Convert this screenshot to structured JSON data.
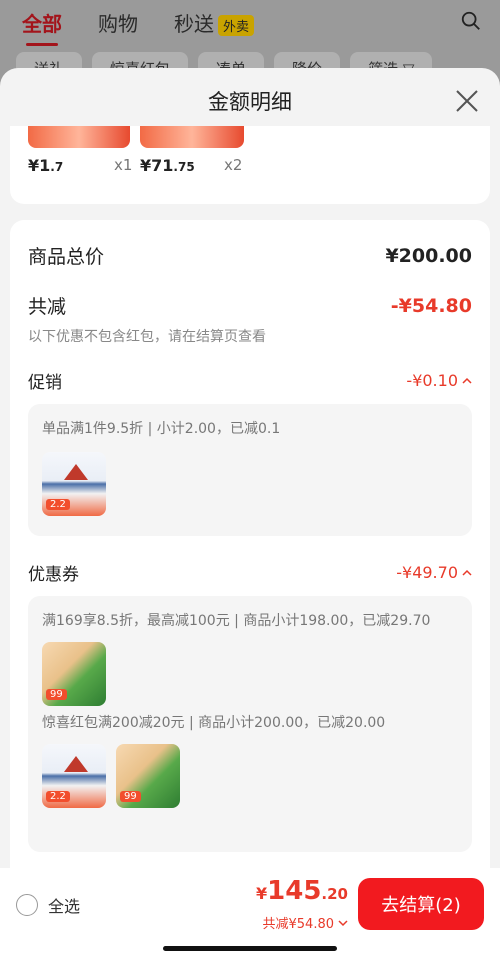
{
  "background_app": {
    "tabs": [
      {
        "label": "全部",
        "active": true
      },
      {
        "label": "购物",
        "active": false
      },
      {
        "label": "秒送",
        "active": false,
        "badge": "外卖"
      }
    ],
    "filters": [
      "送礼",
      "惊喜红包",
      "凑单",
      "降价",
      "筛选 ▽"
    ]
  },
  "sheet": {
    "title": "金额明细",
    "products": [
      {
        "price_main": "¥1",
        "price_dec": ".7",
        "qty": "x1"
      },
      {
        "price_main": "¥71",
        "price_dec": ".75",
        "qty": "x2"
      }
    ],
    "summary": {
      "total_label": "商品总价",
      "total_value": "¥200.00",
      "discount_label": "共减",
      "discount_value": "-¥54.80",
      "note": "以下优惠不包含红包，请在结算页查看"
    },
    "promotion": {
      "label": "促销",
      "value": "-¥0.10",
      "detail": "单品满1件9.5折 | 小计2.00，已减0.1",
      "thumb_tag": "2.2"
    },
    "coupon": {
      "label": "优惠券",
      "value": "-¥49.70",
      "detail1": "满169享8.5折，最高减100元 | 商品小计198.00，已减29.70",
      "thumb_tag1": "99",
      "detail2": "惊喜红包满200减20元 | 商品小计200.00，已减20.00",
      "thumb_tag2a": "2.2",
      "thumb_tag2b": "99"
    }
  },
  "bottom_bar": {
    "select_all_label": "全选",
    "total_yen": "¥",
    "total_int": "145",
    "total_dec": ".20",
    "discount_text": "共减¥54.80",
    "checkout_label": "去结算(2)"
  },
  "colors": {
    "accent_red": "#e83a2a",
    "checkout_bg": "#f21a1f"
  }
}
